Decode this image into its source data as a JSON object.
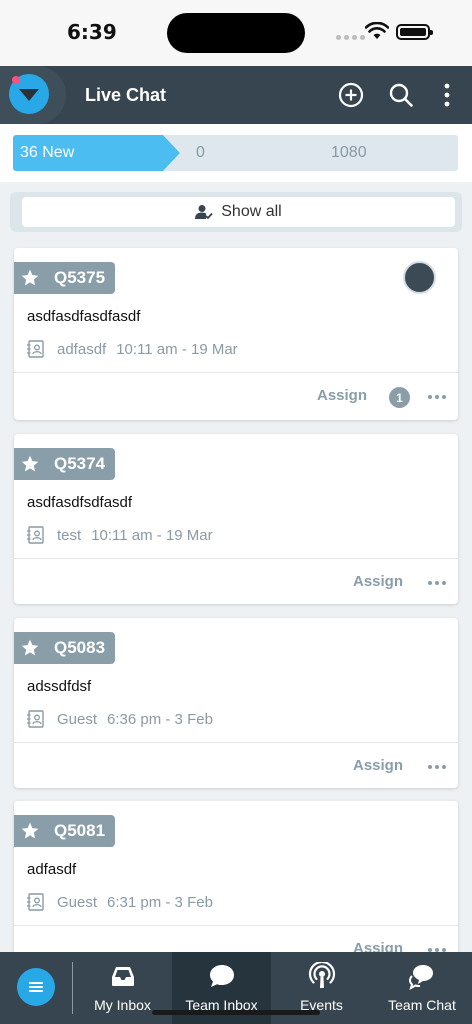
{
  "status_bar": {
    "time": "6:39"
  },
  "header": {
    "title": "Live Chat"
  },
  "filters": [
    {
      "label": "36 New",
      "active": true
    },
    {
      "label": "0",
      "active": false
    },
    {
      "label": "1080",
      "active": false
    }
  ],
  "show_all": {
    "label": "Show all"
  },
  "tickets": [
    {
      "id": "Q5375",
      "subject": "asdfasdfasdfasdf",
      "contact": "adfasdf",
      "time": "10:11 am - 19 Mar",
      "assign_label": "Assign",
      "assign_count": "1",
      "has_agent_avatar": true
    },
    {
      "id": "Q5374",
      "subject": "asdfasdfsdfasdf",
      "contact": "test",
      "time": "10:11 am - 19 Mar",
      "assign_label": "Assign",
      "assign_count": "",
      "has_agent_avatar": false
    },
    {
      "id": "Q5083",
      "subject": "adssdfdsf",
      "contact": "Guest",
      "time": "6:36 pm - 3 Feb",
      "assign_label": "Assign",
      "assign_count": "",
      "has_agent_avatar": false
    },
    {
      "id": "Q5081",
      "subject": "adfasdf",
      "contact": "Guest",
      "time": "6:31 pm - 3 Feb",
      "assign_label": "Assign",
      "assign_count": "",
      "has_agent_avatar": false
    }
  ],
  "bottom_nav": {
    "items": [
      {
        "label": "My Inbox",
        "icon": "inbox-icon",
        "active": false
      },
      {
        "label": "Team Inbox",
        "icon": "chat-bubble-icon",
        "active": true
      },
      {
        "label": "Events",
        "icon": "broadcast-icon",
        "active": false
      },
      {
        "label": "Team Chat",
        "icon": "team-chat-icon",
        "active": false
      }
    ]
  },
  "colors": {
    "header_bg": "#36454f",
    "accent": "#29a8e8",
    "badge": "#8a9ea9",
    "step_inactive": "#dde7ed"
  }
}
